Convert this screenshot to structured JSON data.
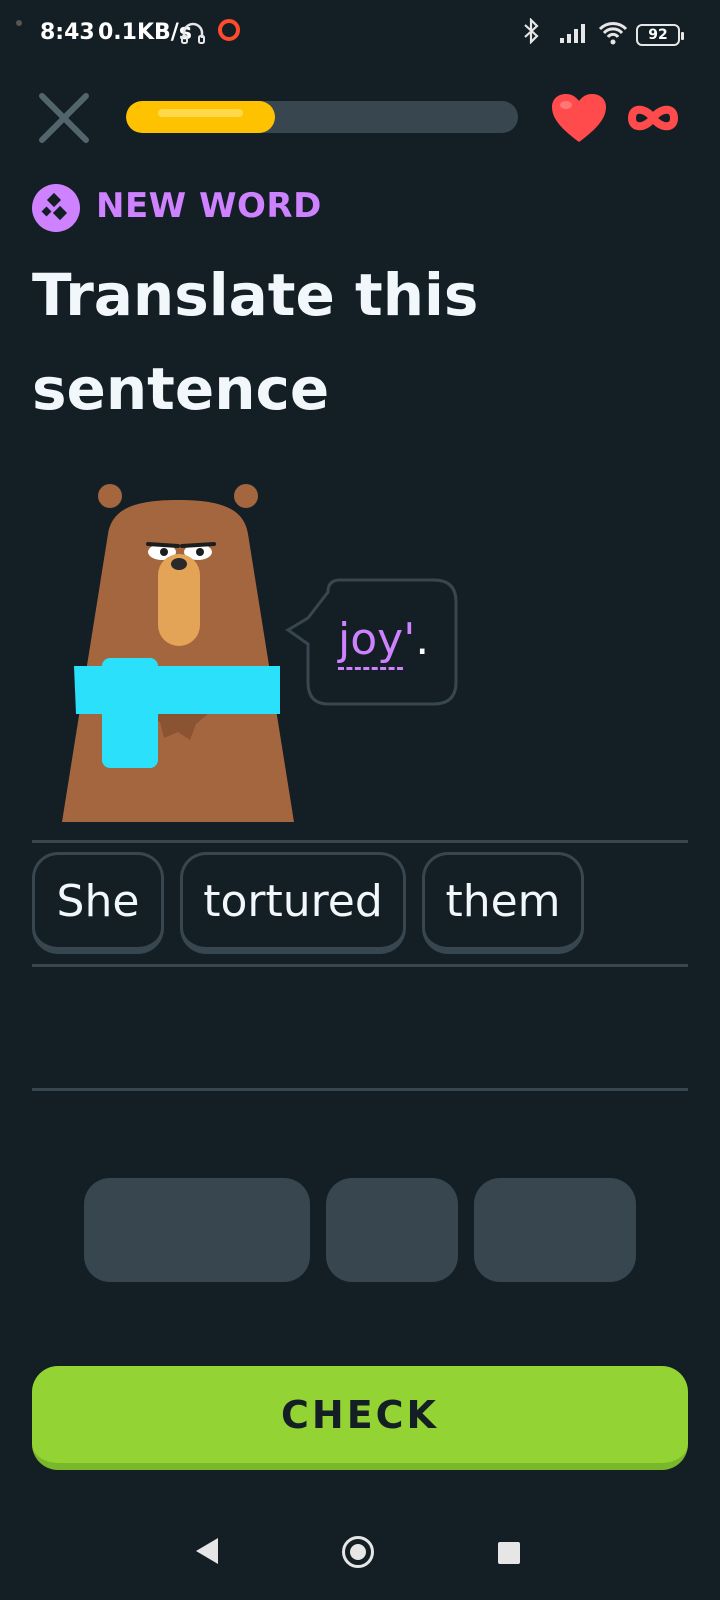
{
  "status_bar": {
    "time": "8:43",
    "net_speed": "0.1KB/s",
    "battery": "92",
    "icons": [
      "headphones-icon",
      "opera-icon",
      "bluetooth-icon",
      "signal-icon",
      "wifi-icon",
      "battery-icon"
    ]
  },
  "lesson": {
    "progress": 0.38,
    "hearts": "∞",
    "colors": {
      "progress": "#ffc200",
      "heart": "#ff4b4b",
      "accent": "#ce82ff",
      "check": "#93d333",
      "background": "#141f25"
    }
  },
  "header": {
    "badge": "NEW WORD",
    "title": "Translate this sentence"
  },
  "speech": {
    "word": "joy",
    "apostrophe": "'",
    "period": "."
  },
  "answer": {
    "chips": [
      "She",
      "tortured",
      "them"
    ]
  },
  "word_bank": {
    "slots": 3
  },
  "footer": {
    "check_label": "CHECK"
  }
}
